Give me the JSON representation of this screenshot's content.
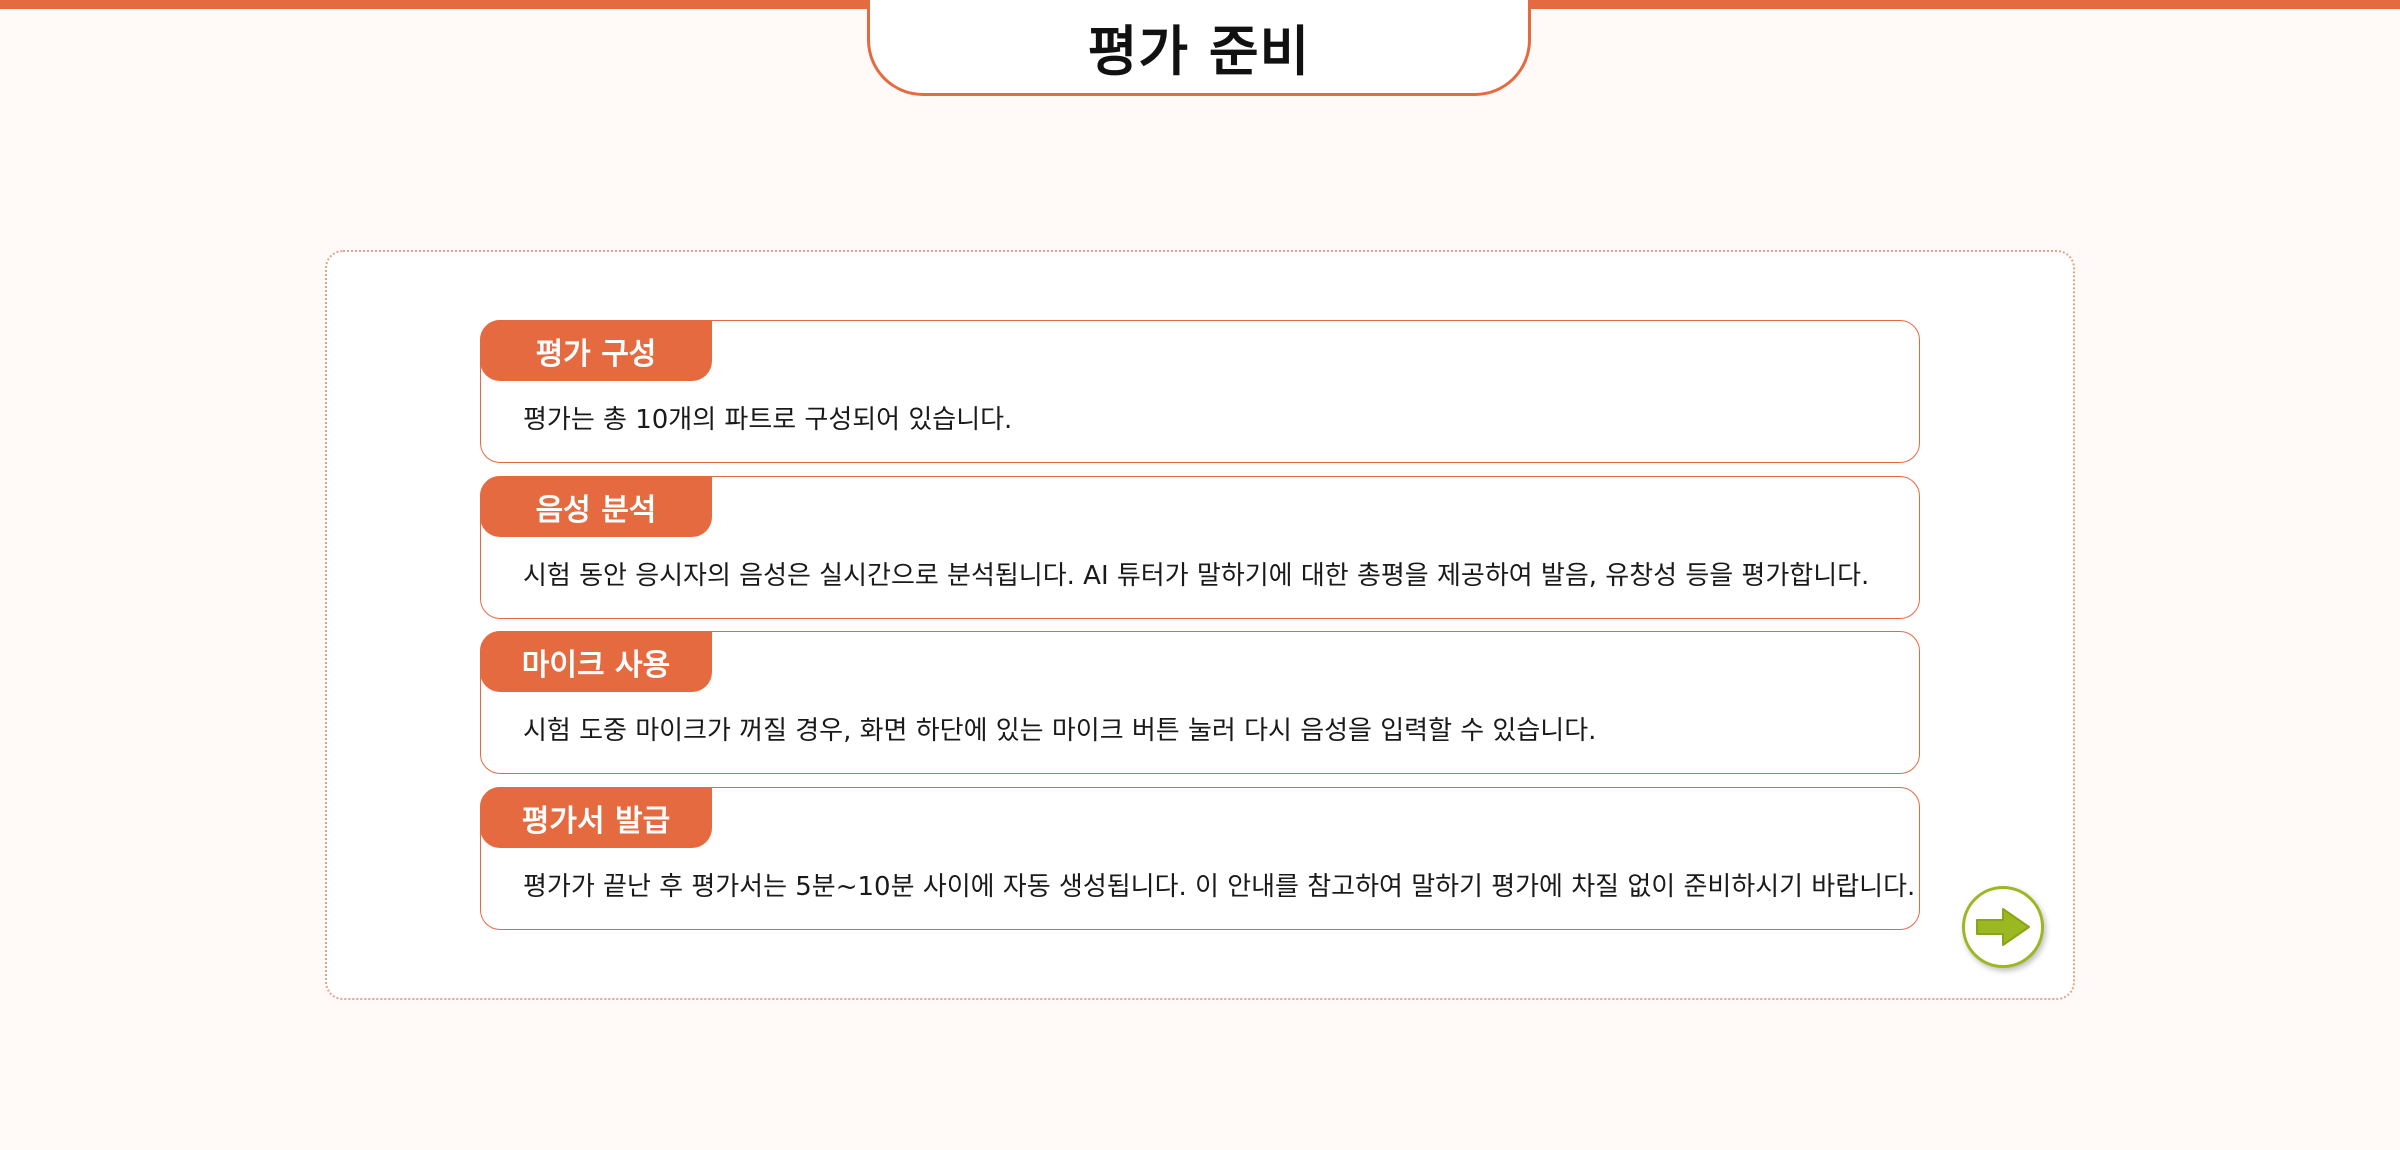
{
  "header": {
    "title": "평가 준비"
  },
  "cards": [
    {
      "label": "평가 구성",
      "text": "평가는 총 10개의 파트로 구성되어 있습니다."
    },
    {
      "label": "음성 분석",
      "text": "시험 동안 응시자의 음성은 실시간으로 분석됩니다. AI 튜터가 말하기에 대한 총평을 제공하여 발음, 유창성 등을 평가합니다."
    },
    {
      "label": "마이크 사용",
      "text": "시험 도중 마이크가 꺼질 경우, 화면 하단에 있는 마이크 버튼 눌러 다시 음성을 입력할 수 있습니다."
    },
    {
      "label": "평가서 발급",
      "text": "평가가 끝난 후 평가서는 5분~10분 사이에 자동 생성됩니다. 이 안내를 참고하여 말하기 평가에 차질 없이 준비하시기 바랍니다."
    }
  ],
  "next_button": {
    "icon": "arrow-right-icon"
  },
  "colors": {
    "accent": "#e66a3f",
    "next_button": "#9bb820",
    "background": "#fffaf7"
  }
}
